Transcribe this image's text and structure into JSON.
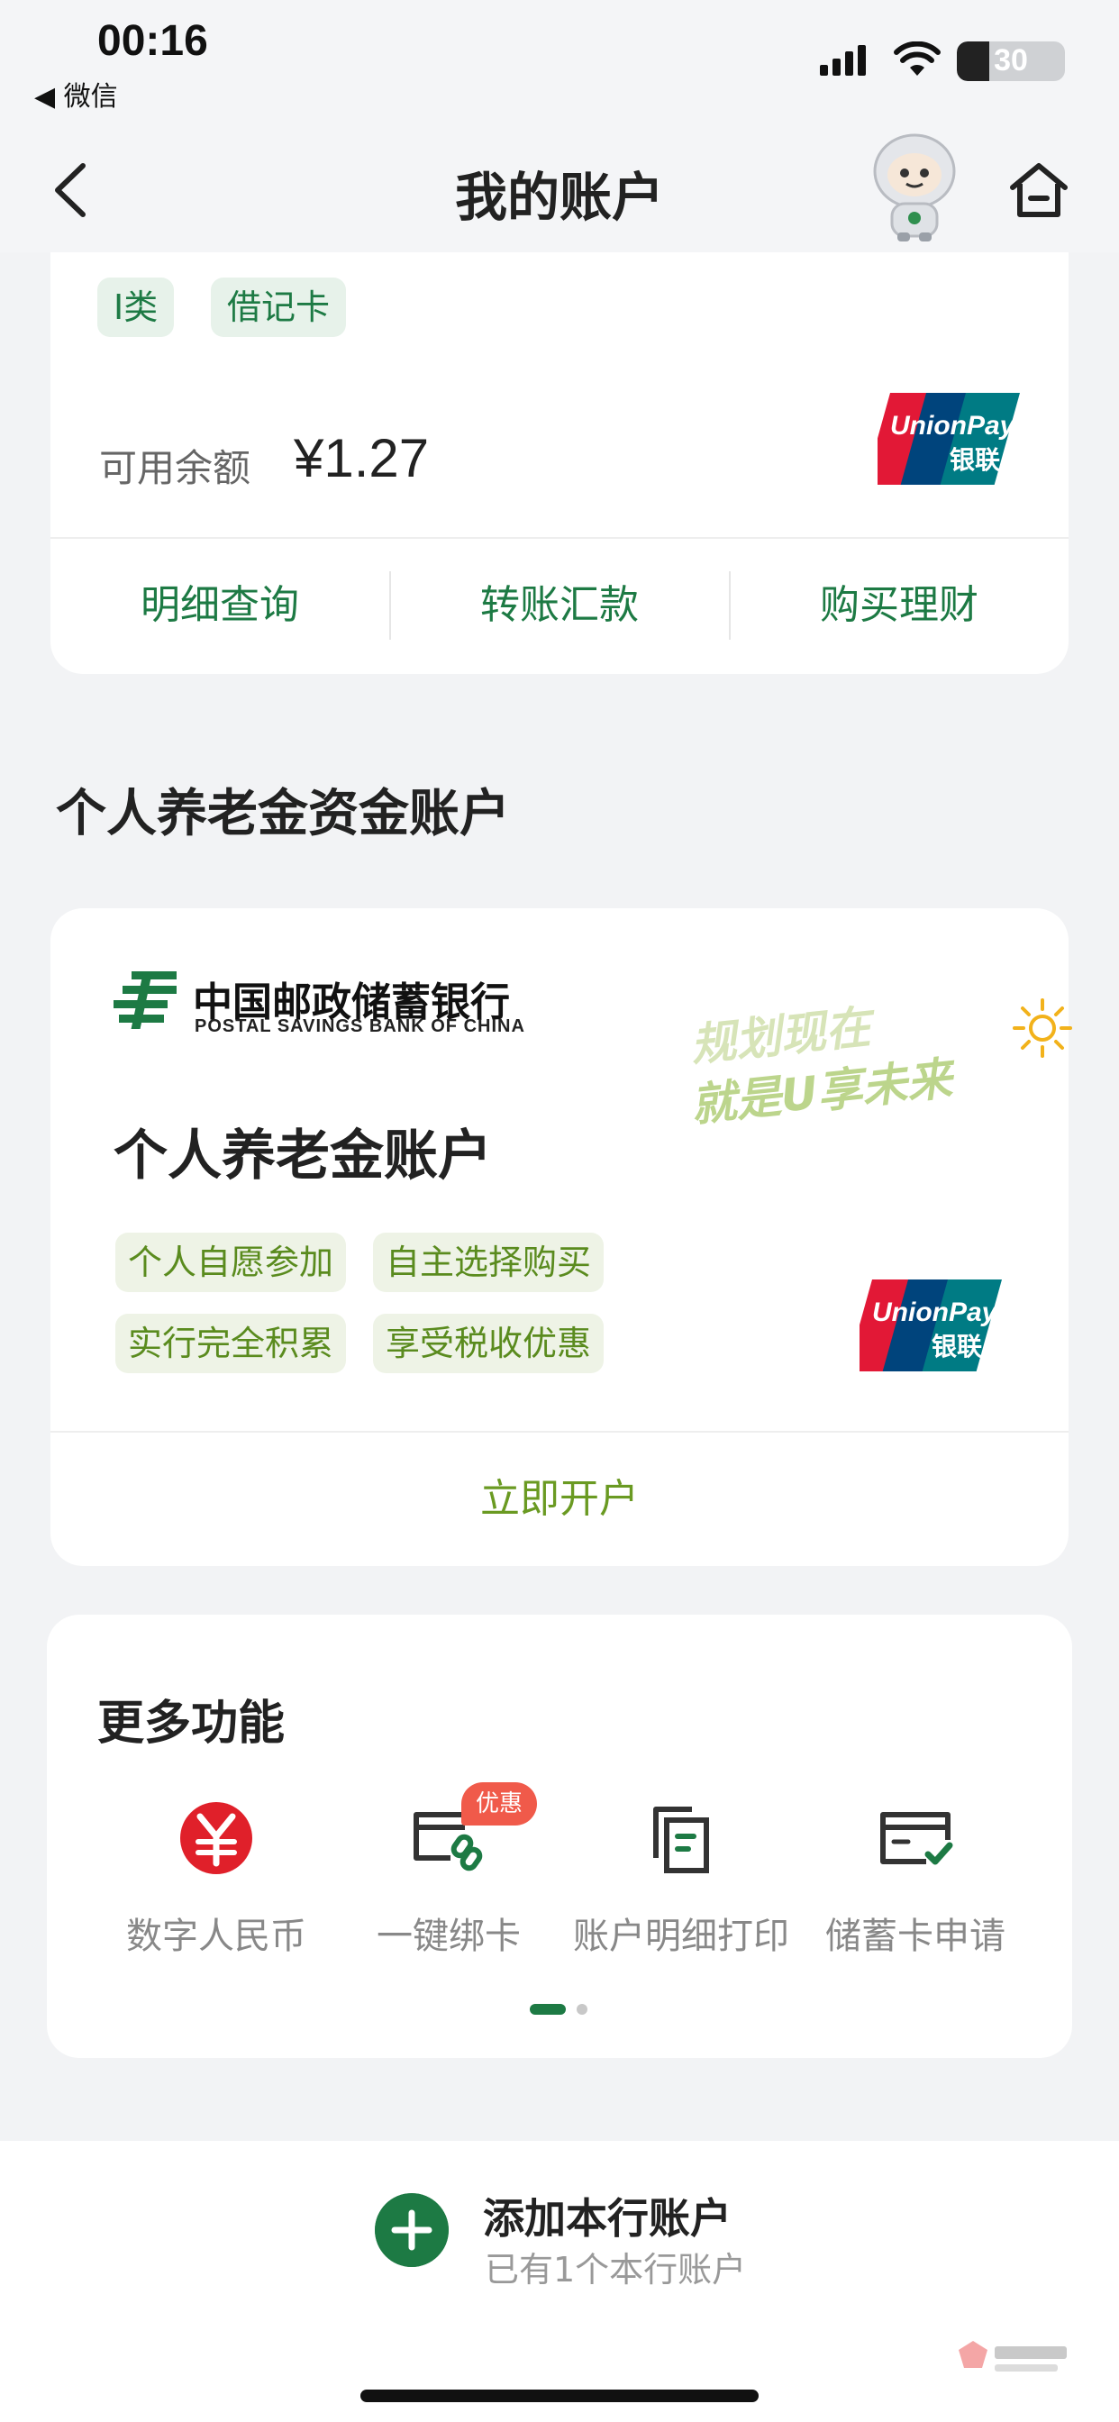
{
  "status_bar": {
    "time": "00:16",
    "back_app": "◀ 微信",
    "battery_percent": 30,
    "battery_text": "30"
  },
  "nav": {
    "title": "我的账户",
    "back_icon": "chevron-left-icon",
    "mascot_icon": "robot-mascot-icon",
    "home_icon": "home-icon"
  },
  "debit_card": {
    "tags": [
      "I类",
      "借记卡"
    ],
    "balance_label": "可用余额",
    "balance_value": "¥1.27",
    "actions": [
      "明细查询",
      "转账汇款",
      "购买理财"
    ],
    "network_logo": "unionpay-logo"
  },
  "pension_section": {
    "title": "个人养老金资金账户",
    "bank_name_cn": "中国邮政储蓄银行",
    "bank_name_en": "POSTAL SAVINGS BANK OF CHINA",
    "slogan_line1": "规划现在",
    "slogan_line2": "就是U享未来",
    "account_title": "个人养老金账户",
    "features": [
      "个人自愿参加",
      "自主选择购买",
      "实行完全积累",
      "享受税收优惠"
    ],
    "open_button": "立即开户"
  },
  "more_features": {
    "title": "更多功能",
    "items": [
      {
        "label": "数字人民币",
        "icon": "digital-rmb-icon"
      },
      {
        "label": "一键绑卡",
        "icon": "bind-card-icon"
      },
      {
        "label": "账户明细打印",
        "icon": "print-statement-icon"
      },
      {
        "label": "储蓄卡申请",
        "icon": "card-apply-icon"
      }
    ],
    "promo_badge": "优惠"
  },
  "bottom": {
    "add_title": "添加本行账户",
    "add_subtitle": "已有1个本行账户"
  },
  "colors": {
    "brand_green": "#1d7a44",
    "olive_green": "#6a9a22",
    "promo_red": "#f05a4a",
    "rmb_red": "#e0202a"
  }
}
